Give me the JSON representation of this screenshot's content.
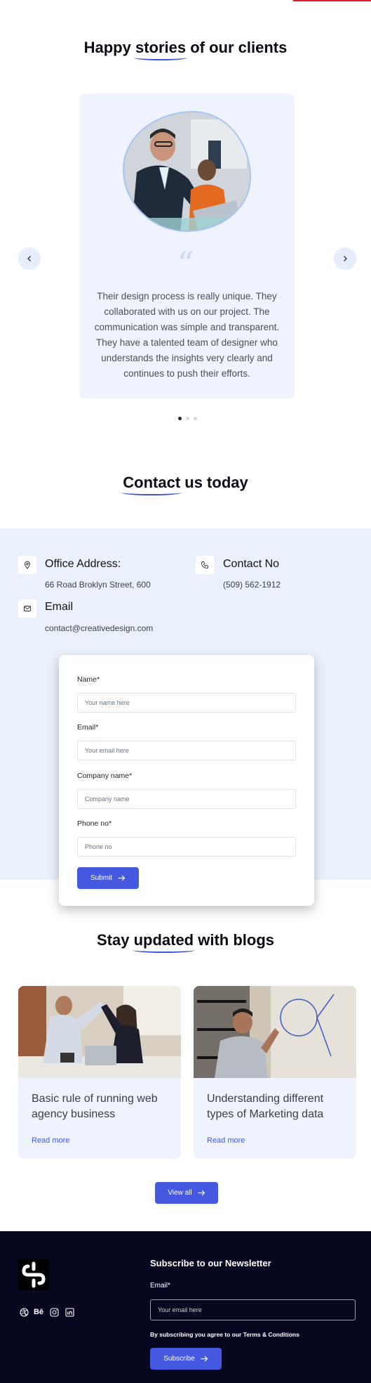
{
  "testimonials": {
    "title_pre": "Happy ",
    "title_hl": "stories",
    "title_post": " of our clients",
    "quote_glyph": "“",
    "text": "Their design process is really unique. They collaborated with us on our project. The communication was simple and transparent. They have a talented team of designer who understands the insights very clearly and continues to push their efforts.",
    "active_slide": 1,
    "slide_count": 3
  },
  "contact": {
    "title_hl": "Contact",
    "title_post": " us today",
    "office_title": "Office Address:",
    "office_value": "66 Road Broklyn Street, 600",
    "phone_title": "Contact No",
    "phone_value": "(509) 562-1912",
    "email_title": "Email",
    "email_value": "contact@creativedesign.com"
  },
  "form": {
    "name_label": "Name*",
    "name_placeholder": "Your name here",
    "email_label": "Email*",
    "email_placeholder": "Your email here",
    "company_label": "Company name*",
    "company_placeholder": "Company name",
    "phone_label": "Phone no*",
    "phone_placeholder": "Phone no",
    "submit_label": "Submit"
  },
  "blogs": {
    "title_pre": "Stay ",
    "title_hl": "updated",
    "title_post": " with blogs",
    "items": [
      {
        "title": "Basic rule of running web agency business",
        "link": "Read more"
      },
      {
        "title": "Understanding different types of Marketing data",
        "link": "Read more"
      }
    ],
    "view_all_label": "View all"
  },
  "footer": {
    "newsletter_title": "Subscribe to our Newsletter",
    "email_label": "Email*",
    "email_placeholder": "Your email here",
    "terms_text": "By subscribing you agree to our Terms & Conditions",
    "subscribe_label": "Subscribe",
    "behance_text": "Bē"
  },
  "colors": {
    "accent": "#4458e0",
    "light_bg": "#eaf1fc",
    "footer_bg": "#070720"
  }
}
